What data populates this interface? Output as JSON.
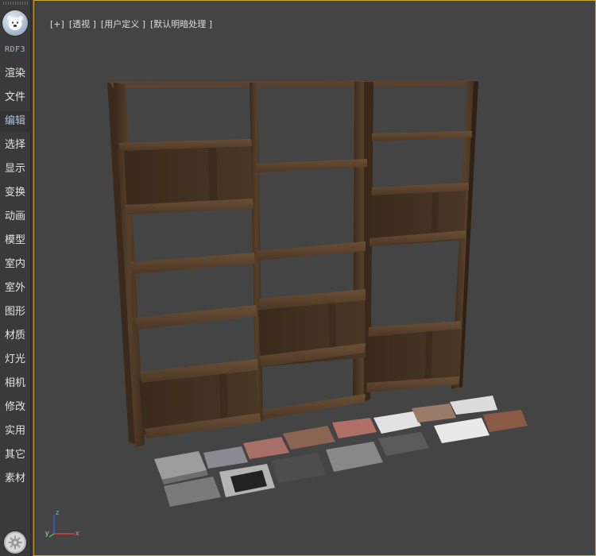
{
  "sidebar": {
    "brand": "RDF3",
    "items": [
      {
        "label": "渲染",
        "name": "sidebar-item-render"
      },
      {
        "label": "文件",
        "name": "sidebar-item-file"
      },
      {
        "label": "编辑",
        "name": "sidebar-item-edit",
        "active": true
      },
      {
        "label": "选择",
        "name": "sidebar-item-select"
      },
      {
        "label": "显示",
        "name": "sidebar-item-display"
      },
      {
        "label": "变换",
        "name": "sidebar-item-transform"
      },
      {
        "label": "动画",
        "name": "sidebar-item-animation"
      },
      {
        "label": "模型",
        "name": "sidebar-item-model"
      },
      {
        "label": "室内",
        "name": "sidebar-item-interior"
      },
      {
        "label": "室外",
        "name": "sidebar-item-exterior"
      },
      {
        "label": "图形",
        "name": "sidebar-item-shapes"
      },
      {
        "label": "材质",
        "name": "sidebar-item-material"
      },
      {
        "label": "灯光",
        "name": "sidebar-item-lights"
      },
      {
        "label": "相机",
        "name": "sidebar-item-camera"
      },
      {
        "label": "修改",
        "name": "sidebar-item-modify"
      },
      {
        "label": "实用",
        "name": "sidebar-item-utilities"
      },
      {
        "label": "其它",
        "name": "sidebar-item-other"
      },
      {
        "label": "素材",
        "name": "sidebar-item-assets"
      }
    ],
    "logo_icon": "bear-logo-icon",
    "settings_icon": "gear-icon"
  },
  "viewport": {
    "labels": {
      "plus": "[+]",
      "view": "[透视 ]",
      "custom": "[用户定义 ]",
      "shading": "[默认明暗处理 ]"
    },
    "border_color": "#c9a535",
    "axis": {
      "x": "x",
      "y": "y",
      "z": "z"
    }
  },
  "colors": {
    "background": "#444444",
    "sidebar": "#3a3a3a",
    "wood": "#4a3524",
    "active_item": "#a9c3dd"
  }
}
